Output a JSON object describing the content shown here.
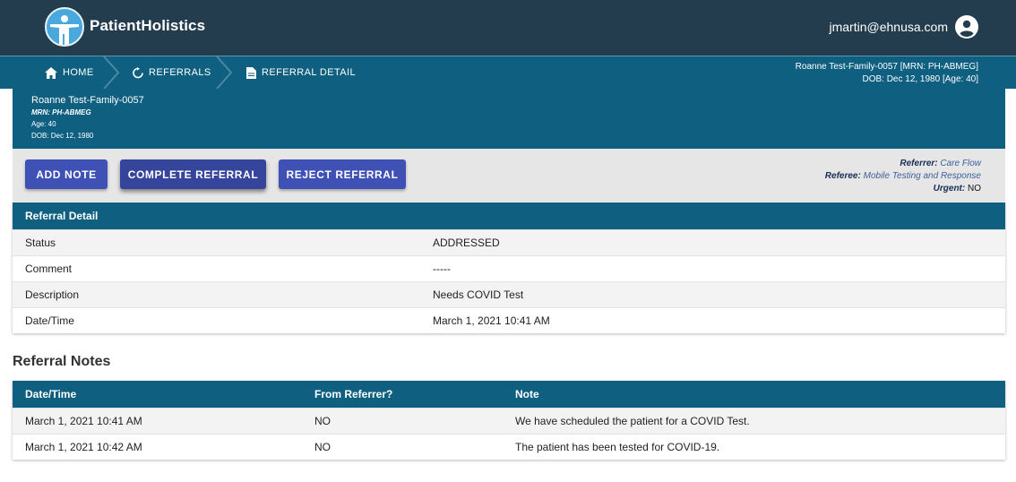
{
  "header": {
    "brand": "PatientHolistics",
    "user_email": "jmartin@ehnusa.com"
  },
  "breadcrumb": {
    "home": "HOME",
    "referrals": "REFERRALS",
    "detail": "REFERRAL DETAIL"
  },
  "nav_patient": {
    "line1": "Roanne Test-Family-0057 [MRN: PH-ABMEG]",
    "line2": "DOB: Dec 12, 1980 [Age: 40]"
  },
  "patient": {
    "name": "Roanne Test-Family-0057",
    "mrn": "MRN: PH-ABMEG",
    "age": "Age: 40",
    "dob": "DOB: Dec 12, 1980"
  },
  "actions": {
    "add_note": "ADD NOTE",
    "complete": "COMPLETE REFERRAL",
    "reject": "REJECT REFERRAL"
  },
  "referral_meta": {
    "referrer_label": "Referrer:",
    "referrer_value": "Care Flow",
    "referee_label": "Referee:",
    "referee_value": "Mobile Testing and Response",
    "urgent_label": "Urgent:",
    "urgent_value": "NO"
  },
  "detail": {
    "title": "Referral Detail",
    "rows": [
      {
        "label": "Status",
        "value": "ADDRESSED"
      },
      {
        "label": "Comment",
        "value": "-----"
      },
      {
        "label": "Description",
        "value": "Needs COVID Test"
      },
      {
        "label": "Date/Time",
        "value": "March 1, 2021 10:41 AM"
      }
    ]
  },
  "notes": {
    "title": "Referral Notes",
    "columns": [
      "Date/Time",
      "From Referrer?",
      "Note"
    ],
    "rows": [
      {
        "datetime": "March 1, 2021 10:41 AM",
        "from_referrer": "NO",
        "note": "We have scheduled the patient for a COVID Test."
      },
      {
        "datetime": "March 1, 2021 10:42 AM",
        "from_referrer": "NO",
        "note": "The patient has been tested for COVID-19."
      }
    ]
  },
  "colors": {
    "topbar": "#233d4e",
    "primary": "#0e5f80",
    "button": "#3f51b5"
  }
}
